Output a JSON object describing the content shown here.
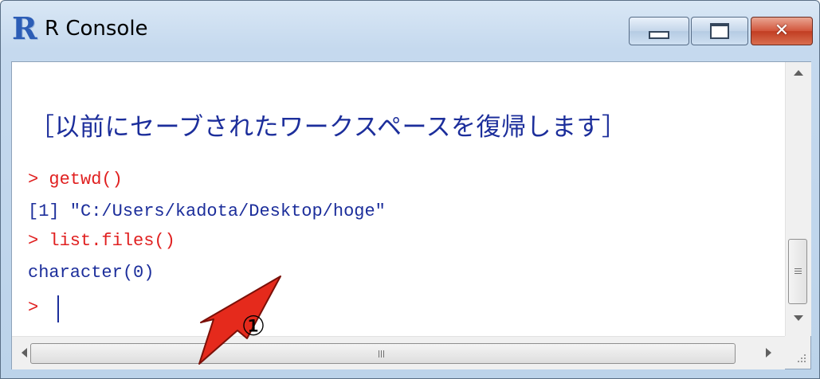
{
  "window": {
    "title": "R Console",
    "app_icon_glyph": "R"
  },
  "caption_buttons": {
    "minimize": "minimize-icon",
    "maximize": "maximize-icon",
    "close_glyph": "✕"
  },
  "console": {
    "restore_message": "［以前にセーブされたワークスペースを復帰します］",
    "lines": [
      {
        "prompt": "> ",
        "text": "getwd()"
      },
      {
        "prompt": "",
        "text": "[1] \"C:/Users/kadota/Desktop/hoge\""
      },
      {
        "prompt": "> ",
        "text": "list.files()"
      },
      {
        "prompt": "",
        "text": "character(0)"
      },
      {
        "prompt": "> ",
        "text": ""
      }
    ]
  },
  "annotation": {
    "callout_number": "①",
    "arrow_color": "#e52a1c"
  }
}
